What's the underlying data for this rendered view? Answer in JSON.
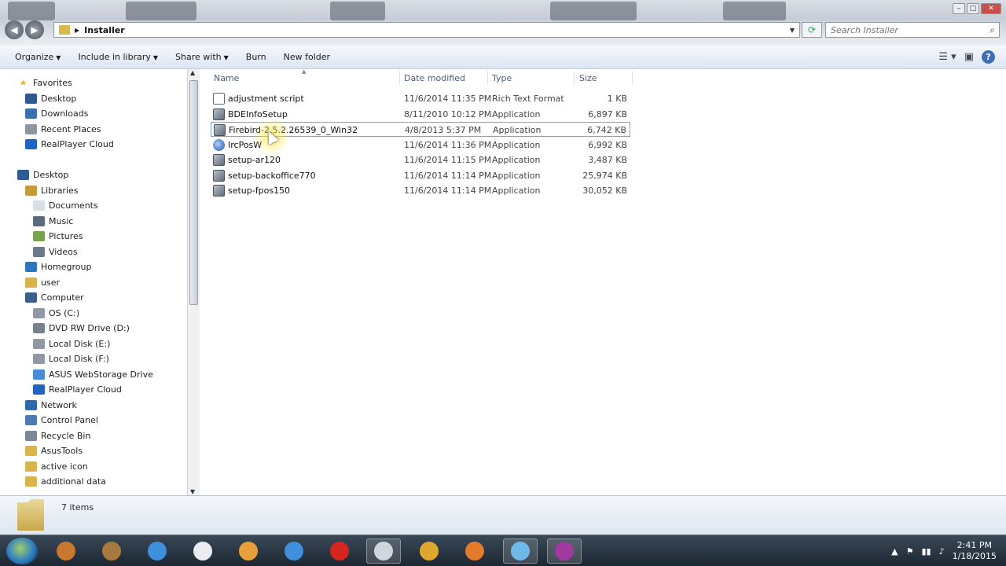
{
  "window": {
    "breadcrumb": "Installer",
    "search_placeholder": "Search Installer",
    "controls": [
      "–",
      "□",
      "✕"
    ]
  },
  "toolbar": {
    "organize": "Organize",
    "include_in_library": "Include in library",
    "share_with": "Share with",
    "burn": "Burn",
    "new_folder": "New folder",
    "help": "?"
  },
  "nav": {
    "items": [
      {
        "label": "Favorites",
        "icon": "star-icon"
      },
      {
        "label": "Desktop",
        "icon": "desktop-icon"
      },
      {
        "label": "Downloads",
        "icon": "downloads-icon"
      },
      {
        "label": "Recent Places",
        "icon": "recent-places-icon"
      },
      {
        "label": "RealPlayer Cloud",
        "icon": "realplayer-icon"
      },
      {
        "label": "Desktop",
        "icon": "desktop-icon"
      },
      {
        "label": "Libraries",
        "icon": "libraries-icon"
      },
      {
        "label": "Documents",
        "icon": "documents-icon"
      },
      {
        "label": "Music",
        "icon": "music-icon"
      },
      {
        "label": "Pictures",
        "icon": "pictures-icon"
      },
      {
        "label": "Videos",
        "icon": "videos-icon"
      },
      {
        "label": "Homegroup",
        "icon": "homegroup-icon"
      },
      {
        "label": "user",
        "icon": "user-folder-icon"
      },
      {
        "label": "Computer",
        "icon": "computer-icon"
      },
      {
        "label": "OS (C:)",
        "icon": "drive-icon"
      },
      {
        "label": "DVD RW Drive (D:)",
        "icon": "dvd-drive-icon"
      },
      {
        "label": "Local Disk (E:)",
        "icon": "drive-icon"
      },
      {
        "label": "Local Disk (F:)",
        "icon": "drive-icon"
      },
      {
        "label": "ASUS WebStorage Drive",
        "icon": "cloud-drive-icon"
      },
      {
        "label": "RealPlayer Cloud",
        "icon": "realplayer-icon"
      },
      {
        "label": "Network",
        "icon": "network-icon"
      },
      {
        "label": "Control Panel",
        "icon": "control-panel-icon"
      },
      {
        "label": "Recycle Bin",
        "icon": "recycle-bin-icon"
      },
      {
        "label": "AsusTools",
        "icon": "folder-icon"
      },
      {
        "label": "active icon",
        "icon": "folder-icon"
      },
      {
        "label": "additional data",
        "icon": "folder-icon"
      }
    ]
  },
  "columns": {
    "name": "Name",
    "date_modified": "Date modified",
    "type": "Type",
    "size": "Size"
  },
  "files": [
    {
      "name": "adjustment script",
      "date": "11/6/2014 11:35 PM",
      "type": "Rich Text Format",
      "size": "1 KB",
      "icon": "document-icon"
    },
    {
      "name": "BDEInfoSetup",
      "date": "8/11/2010 10:12 PM",
      "type": "Application",
      "size": "6,897 KB",
      "icon": "installer-icon"
    },
    {
      "name": "Firebird-2.5.2.26539_0_Win32",
      "date": "4/8/2013 5:37 PM",
      "type": "Application",
      "size": "6,742 KB",
      "icon": "installer-icon"
    },
    {
      "name": "IrcPosW",
      "date": "11/6/2014 11:36 PM",
      "type": "Application",
      "size": "6,992 KB",
      "icon": "app-globe-icon"
    },
    {
      "name": "setup-ar120",
      "date": "11/6/2014 11:15 PM",
      "type": "Application",
      "size": "3,487 KB",
      "icon": "installer-icon"
    },
    {
      "name": "setup-backoffice770",
      "date": "11/6/2014 11:14 PM",
      "type": "Application",
      "size": "25,974 KB",
      "icon": "installer-icon"
    },
    {
      "name": "setup-fpos150",
      "date": "11/6/2014 11:14 PM",
      "type": "Application",
      "size": "30,052 KB",
      "icon": "installer-icon"
    }
  ],
  "status": {
    "item_count": "7 items"
  },
  "taskbar": {
    "apps": [
      "start-orb",
      "media-player-icon",
      "photo-viewer-icon",
      "internet-explorer-icon",
      "calculator-icon",
      "paint-icon",
      "internet-explorer-icon",
      "opera-icon",
      "file-explorer-icon",
      "chrome-icon",
      "firefox-icon",
      "skype-icon",
      "app-icon"
    ],
    "clock_time": "2:41 PM",
    "clock_date": "1/18/2015"
  }
}
